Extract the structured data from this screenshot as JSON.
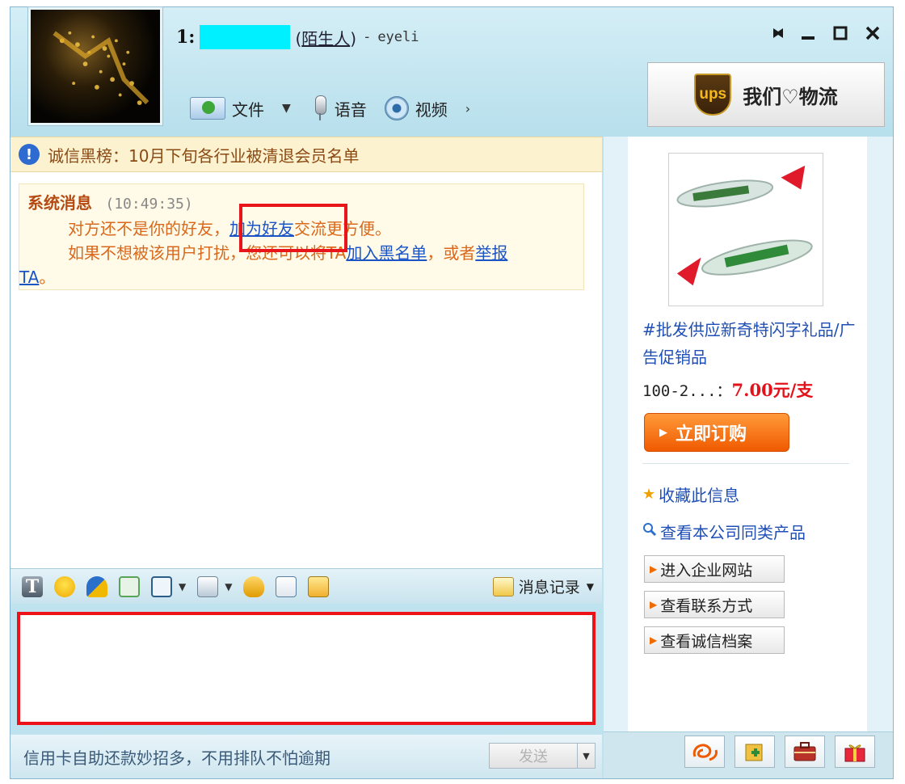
{
  "header": {
    "title_prefix": "1:",
    "relation": "陌生人",
    "separator": "-",
    "username": "eyeli",
    "window_controls": {
      "pin": "pin-icon",
      "minimize": "minimize-icon",
      "maximize": "maximize-icon",
      "close": "close-icon"
    },
    "toolbar": {
      "file_label": "文件",
      "voice_label": "语音",
      "video_label": "视频"
    },
    "ad_banner": {
      "logo_text": "ups",
      "text": "我们♡物流"
    }
  },
  "notice": {
    "text": "诚信黑榜：10月下旬各行业被清退会员名单"
  },
  "system_message": {
    "sender": "系统消息",
    "time": "(10:49:35)",
    "line1_prefix": "对方还不是你的好友，",
    "line1_link": "加为好友",
    "line1_suffix": "交流更方便。",
    "line2_prefix": "如果不想被该用户打扰，您还可以将TA",
    "line2_link1": "加入黑名单",
    "line2_mid": "，或者",
    "line2_link2": "举报",
    "line3_link": "TA",
    "line3_suffix": "。"
  },
  "input_toolbar": {
    "icons": [
      "font-icon",
      "emoticon-icon",
      "magic-icon",
      "screen-shake-icon",
      "screenshot-icon",
      "file-share-icon",
      "bell-icon",
      "note-icon",
      "transfer-icon"
    ],
    "history_label": "消息记录"
  },
  "footer": {
    "tip": "信用卡自助还款妙招多，不用排队不怕逾期",
    "send_label": "发送"
  },
  "side_ad": {
    "product_title": "#批发供应新奇特闪字礼品/广告促销品",
    "price_qty": "100-2...",
    "price_sep": "：",
    "price_value": "7.00元/支",
    "buy_label": "立即订购",
    "fav_label": "收藏此信息",
    "similar_label": "查看本公司同类产品",
    "buttons": [
      "进入企业网站",
      "查看联系方式",
      "查看诚信档案"
    ]
  },
  "side_tabs": [
    "alibaba-icon",
    "add-contact-icon",
    "briefcase-icon",
    "gift-icon"
  ],
  "colors": {
    "accent_blue": "#1b54c7",
    "highlight_red": "#ec1217",
    "notice_bg": "#fdf2cf",
    "buy_orange": "#f05a00",
    "price_red": "#e2121a"
  }
}
